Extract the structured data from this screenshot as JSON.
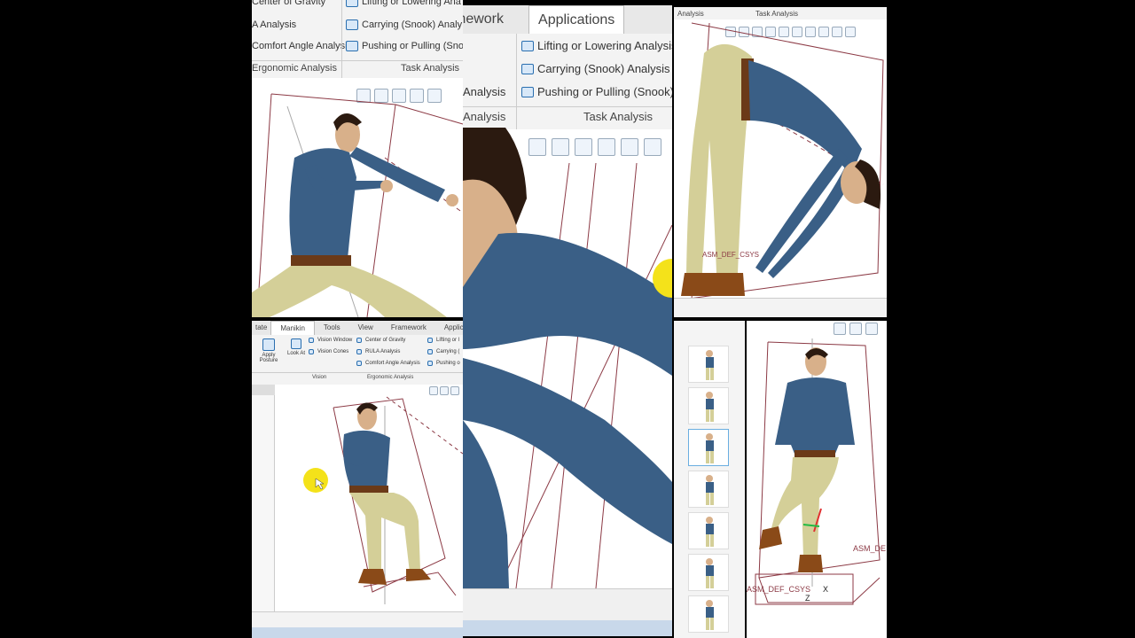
{
  "p1": {
    "ribbon_items": [
      "Center of Gravity",
      "A Analysis",
      "Comfort Angle Analysis",
      "Lifting or Lowering Ana",
      "Carrying (Snook) Analy",
      "Pushing or Pulling (Snook"
    ],
    "groups": [
      "Ergonomic Analysis",
      "Task Analysis"
    ]
  },
  "p2": {
    "tabs": [
      "Framework",
      "Applications"
    ],
    "items": [
      "Lifting or Lowering Analysis",
      "Carrying (Snook) Analysis",
      "Pushing or Pulling (Snook) A"
    ],
    "partial_items": [
      "Analysis"
    ],
    "groups": [
      "Analysis",
      "Task Analysis"
    ]
  },
  "p3": {
    "groups": [
      "Analysis",
      "Task Analysis"
    ],
    "csys_label": "ASM_DEF_CSYS"
  },
  "p4": {
    "tabs": [
      "tate",
      "Manikin",
      "Tools",
      "View",
      "Framework",
      "Applica"
    ],
    "apply_posture": "Apply Posture",
    "look_at": "Look At",
    "vision_window": "Vision Window",
    "vision_cones": "Vision Cones",
    "vision_group": "Vision",
    "ergo_items": [
      "Center of Gravity",
      "RULA Analysis",
      "Comfort Angle Analysis"
    ],
    "ergo_group": "Ergonomic Analysis",
    "task_items": [
      "Lifting or l",
      "Carrying (",
      "Pushing o"
    ]
  },
  "p6": {
    "csys_label": "ASM_DEF_CSYS",
    "csys_label_right": "ASM_DE",
    "axis_x": "X",
    "axis_z": "Z"
  },
  "colors": {
    "shirt": "#3a5f86",
    "pants": "#d4cf98",
    "skin": "#d8b08a",
    "hair": "#2b1a10",
    "frame": "#8c3a45",
    "cursor": "#f4e21a"
  }
}
